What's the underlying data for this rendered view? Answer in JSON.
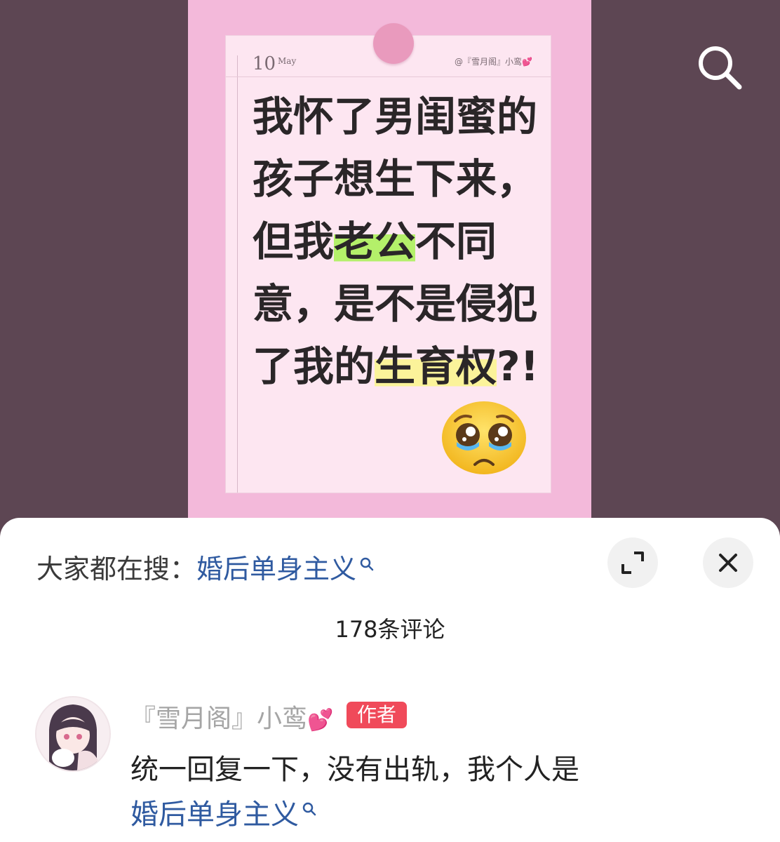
{
  "post": {
    "date_day": "10",
    "date_month": "May",
    "handle": "@『雪月阁』小鸾💕",
    "headline_lines": [
      {
        "parts": [
          "我怀了男闺蜜的"
        ]
      },
      {
        "parts": [
          "孩子想生下来，"
        ]
      },
      {
        "parts": [
          "但我",
          "老公",
          "不同"
        ]
      },
      {
        "parts": [
          "意，是不是侵犯"
        ]
      },
      {
        "parts": [
          "了我的",
          "生育权",
          "?!"
        ]
      }
    ],
    "emoji": "pleading-crying-face"
  },
  "header": {
    "search_icon": "search-icon"
  },
  "sheet": {
    "trending_label": "大家都在搜：",
    "trending_term": "婚后单身主义",
    "expand_icon": "expand-icon",
    "close_icon": "close-icon",
    "comment_count": "178条评论"
  },
  "comment": {
    "username": "『雪月阁』小鸾",
    "username_emoji": "💕",
    "badge": "作者",
    "text": "统一回复一下，没有出轨，我个人是",
    "link": "婚后单身主义"
  },
  "colors": {
    "background": "#5d4652",
    "pink_panel": "#f3b9da",
    "paper": "#fde6f1",
    "link_blue": "#2f5aa0",
    "badge_red": "#f04a5a",
    "highlight_green": "#b4f06a",
    "highlight_yellow": "#fbf39a"
  }
}
